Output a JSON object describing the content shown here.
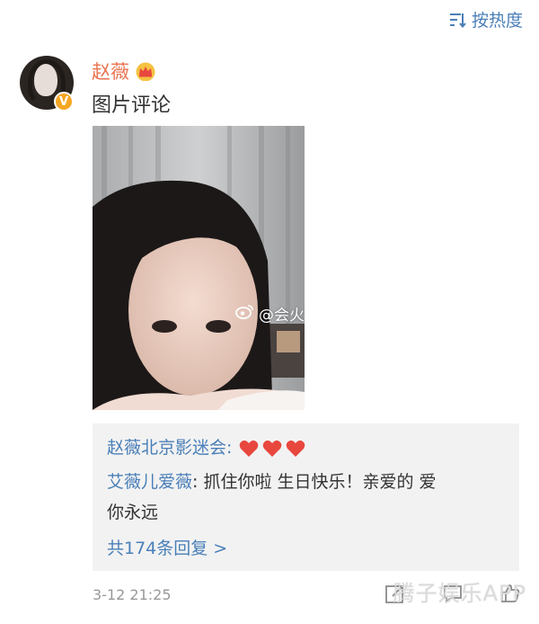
{
  "header": {
    "sort_label": "按热度",
    "sort_icon": "sort-icon"
  },
  "comment": {
    "author": "赵薇",
    "author_badge": "crown-icon",
    "verified_badge": "V",
    "text": "图片评论",
    "image_watermark": "@会火",
    "timestamp": "3-12 21:25"
  },
  "replies": {
    "items": [
      {
        "author": "赵薇北京影迷会",
        "separator": ": ",
        "body": "",
        "hearts": 3
      },
      {
        "author": "艾薇儿爱薇",
        "separator": ": ",
        "body_line1": "抓住你啦 生日快乐！亲爱的 爱",
        "body_line2": "你永远"
      }
    ],
    "more_label": "共174条回复 >"
  },
  "footer": {
    "site_watermark": "腾子娱乐APP"
  },
  "colors": {
    "accent_blue": "#4a7fb8",
    "username_orange": "#eb7350",
    "heart_red": "#e8473e",
    "verified_gold": "#f5a623"
  }
}
